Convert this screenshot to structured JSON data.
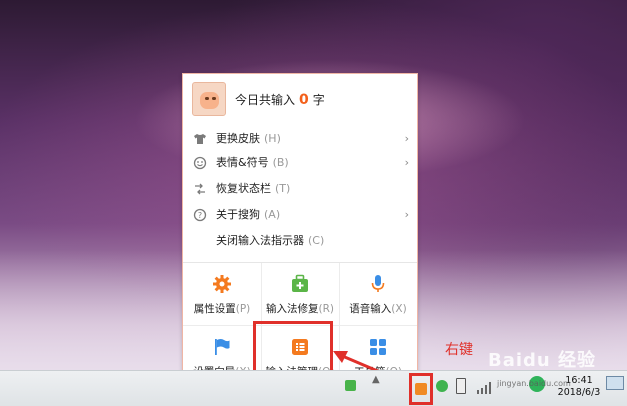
{
  "popup": {
    "header_prefix": "今日共输入",
    "count": "0",
    "header_suffix": "字",
    "menu": [
      {
        "label": "更换皮肤",
        "key": "(H)",
        "icon": "shirt-icon",
        "glyph": "👕",
        "arrow": "›"
      },
      {
        "label": "表情&符号",
        "key": "(B)",
        "icon": "smiley-icon",
        "glyph": "☺",
        "arrow": "›"
      },
      {
        "label": "恢复状态栏",
        "key": "(T)",
        "icon": "toolbar-icon",
        "glyph": "⇆",
        "arrow": ""
      },
      {
        "label": "关于搜狗",
        "key": "(A)",
        "icon": "help-icon",
        "glyph": "?",
        "arrow": "›"
      },
      {
        "label": "关闭输入法指示器",
        "key": "(C)",
        "icon": "",
        "glyph": "",
        "arrow": ""
      }
    ],
    "grid": [
      {
        "label": "属性设置",
        "key": "(P)",
        "icon": "gear-icon"
      },
      {
        "label": "输入法修复",
        "key": "(R)",
        "icon": "repair-kit-icon"
      },
      {
        "label": "语音输入",
        "key": "(X)",
        "icon": "microphone-icon"
      },
      {
        "label": "设置向导",
        "key": "(X)",
        "icon": "flag-icon"
      },
      {
        "label": "输入法管理",
        "key": "(O)",
        "icon": "list-doc-icon"
      },
      {
        "label": "工具箱",
        "key": "(O)",
        "icon": "toolbox-grid-icon"
      }
    ]
  },
  "annotation": {
    "label": "右键"
  },
  "watermark": {
    "text": "Baidu 经验",
    "sub": "jingyan.baidu.com"
  },
  "taskbar": {
    "time": "16:41",
    "date": "2018/6/3"
  },
  "colors": {
    "accent": "#f3601b",
    "highlight": "#e0302a",
    "gear": "#f47a1f",
    "repair": "#5bb548",
    "mic": "#3a8ee6",
    "flag": "#3a8ee6",
    "manage": "#f47a1f",
    "toolbox": "#3a8ee6"
  }
}
